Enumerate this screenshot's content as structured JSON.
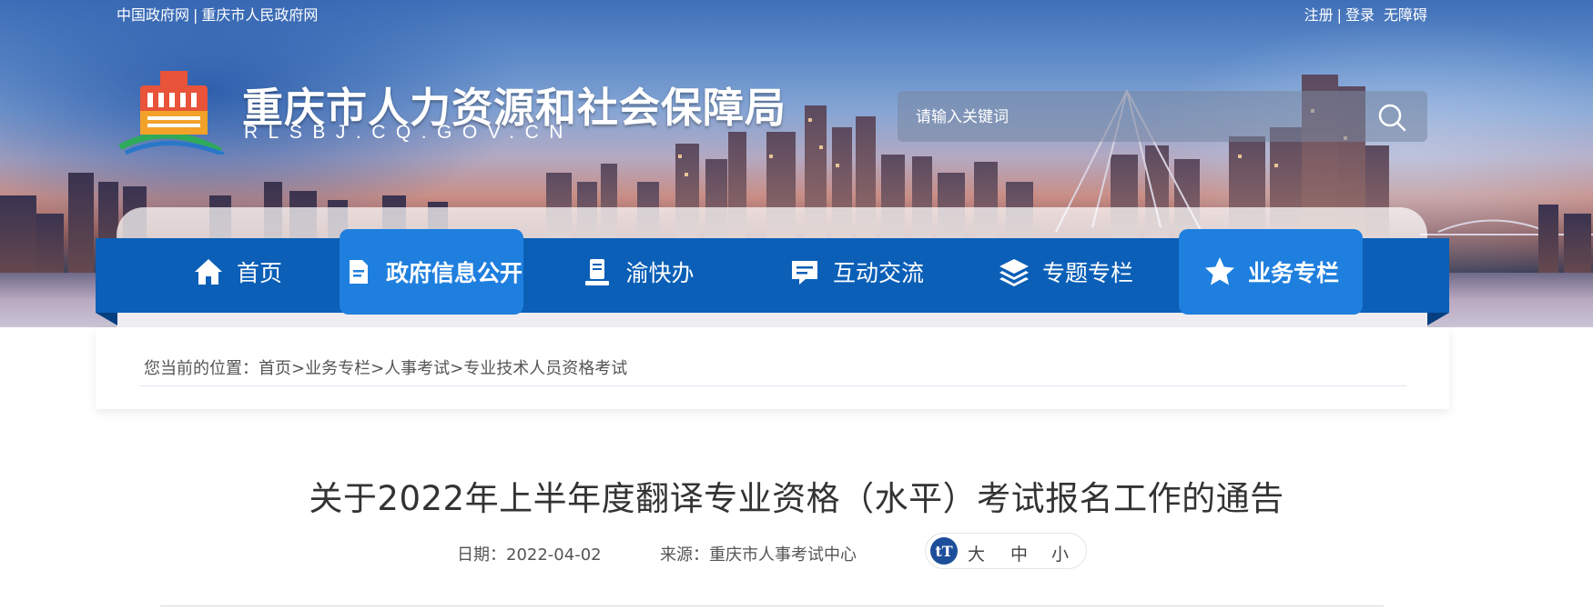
{
  "top_links": {
    "left": [
      "中国政府网",
      "重庆市人民政府网"
    ],
    "right": [
      "注册",
      "登录",
      "无障碍"
    ]
  },
  "site": {
    "title": "重庆市人力资源和社会保障局",
    "domain": "RLSBJ.CQ.GOV.CN"
  },
  "search": {
    "placeholder": "请输入关键词",
    "icon": "search-icon"
  },
  "nav": {
    "items": [
      {
        "label": "首页",
        "icon": "home-icon",
        "active": false
      },
      {
        "label": "政府信息公开",
        "icon": "document-icon",
        "active": true
      },
      {
        "label": "渝快办",
        "icon": "desk-icon",
        "active": false
      },
      {
        "label": "互动交流",
        "icon": "chat-icon",
        "active": false
      },
      {
        "label": "专题专栏",
        "icon": "layers-icon",
        "active": false
      },
      {
        "label": "业务专栏",
        "icon": "star-icon",
        "active": true
      }
    ]
  },
  "breadcrumb": {
    "prefix": "您当前的位置：",
    "items": [
      "首页",
      "业务专栏",
      "人事考试",
      "专业技术人员资格考试"
    ],
    "separator": ">"
  },
  "article": {
    "title": "关于2022年上半年度翻译专业资格（水平）考试报名工作的通告",
    "date_label": "日期：",
    "date": "2022-04-02",
    "source_label": "来源：",
    "source": "重庆市人事考试中心",
    "font_size": {
      "icon_text": "tT",
      "options": [
        "大",
        "中",
        "小"
      ]
    }
  },
  "colors": {
    "nav_bg": "#0b5fb7",
    "nav_active": "#1f7fde",
    "title_text": "#333333"
  }
}
